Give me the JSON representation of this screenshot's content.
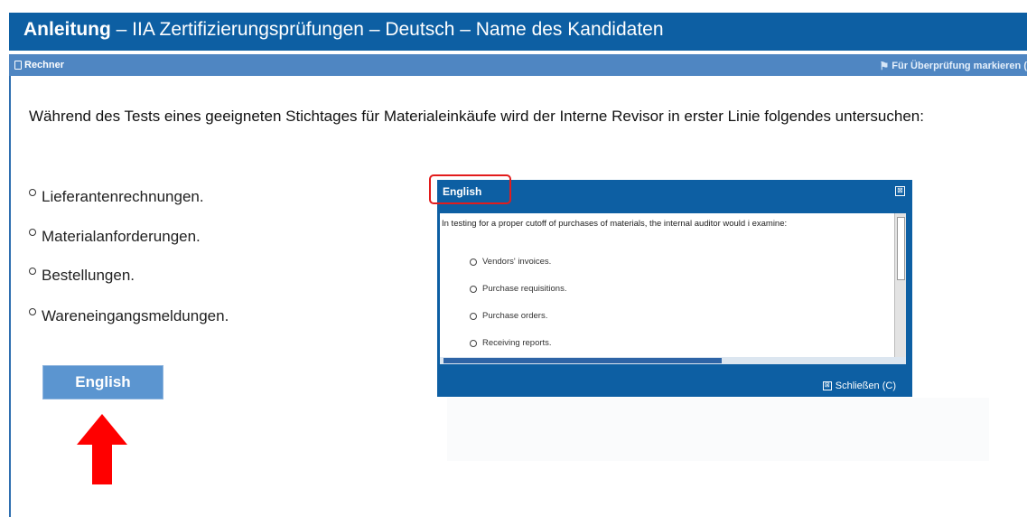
{
  "header": {
    "title_bold": "Anleitung",
    "title_rest": " – IIA Zertifizierungsprüfungen – Deutsch – Name des Kandidaten"
  },
  "toolbar": {
    "calculator_label": "Rechner",
    "mark_label": "Für Überprüfung markieren (",
    "icons": {
      "calculator": "calculator-icon",
      "mark": "flag-icon"
    }
  },
  "question": {
    "text": "Während des Tests eines geeigneten Stichtages für Materialeinkäufe wird der Interne Revisor in erster Linie folgendes untersuchen:",
    "options": [
      "Lieferantenrechnungen.",
      "Materialanforderungen.",
      "Bestellungen.",
      "Wareneingangsmeldungen."
    ]
  },
  "english_button": {
    "label": "English"
  },
  "popup": {
    "title": "English",
    "close_glyph": "⊠",
    "text": "In testing for a proper cutoff of purchases of materials, the internal auditor would i examine:",
    "options": [
      "Vendors' invoices.",
      "Purchase requisitions.",
      "Purchase orders.",
      "Receiving reports."
    ],
    "footer_close": "Schließen (C)"
  },
  "colors": {
    "title_bar": "#0d5fa3",
    "toolbar": "#4f86c2",
    "button": "#5b95d0",
    "highlight": "#e21c1c",
    "arrow": "#ff0000"
  }
}
